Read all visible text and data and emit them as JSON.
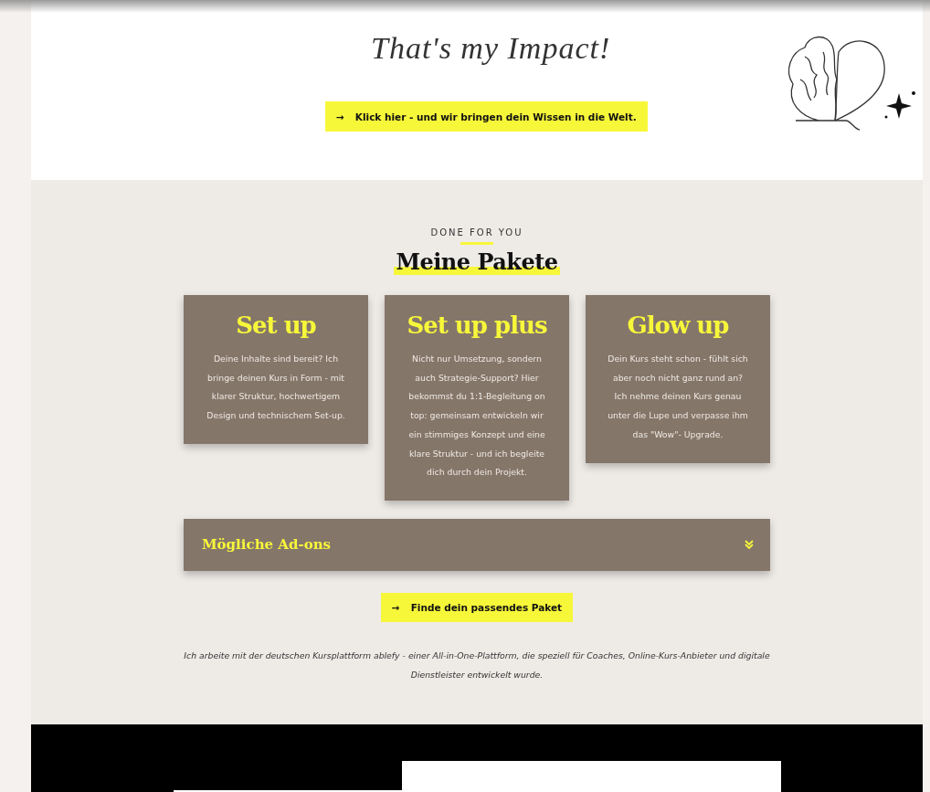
{
  "impact": {
    "signature": "That's my Impact!",
    "button": {
      "icon": "→",
      "label": "Klick hier - und wir bringen dein Wissen in die Welt."
    }
  },
  "packages": {
    "kicker": "DONE FOR YOU",
    "heading": "Meine Pakete",
    "cards": [
      {
        "title": "Set up",
        "text": "Deine Inhalte sind bereit? Ich bringe deinen Kurs in Form - mit klarer Struktur, hochwertigem Design und technischem Set-up."
      },
      {
        "title": "Set up plus",
        "text": "Nicht nur Umsetzung, sondern auch Strategie-Support? Hier bekommst du 1:1-Begleitung on top: gemeinsam entwickeln wir ein stimmiges Konzept und eine klare Struktur - und ich begleite dich durch dein Projekt."
      },
      {
        "title": "Glow up",
        "text": "Dein Kurs steht schon - fühlt sich aber noch nicht ganz rund an? Ich nehme deinen Kurs genau unter die Lupe und verpasse ihm das \"Wow\"- Upgrade."
      }
    ],
    "addons": {
      "title": "Mögliche Ad-ons",
      "expanded": false
    },
    "button": {
      "icon": "→",
      "label": "Finde dein passendes Paket"
    },
    "note": "Ich arbeite mit der deutschen Kursplattform ablefy - einer All-in-One-Plattform, die speziell für Coaches, Online-Kurs-Anbieter und digitale Dienstleister entwickelt wurde."
  }
}
